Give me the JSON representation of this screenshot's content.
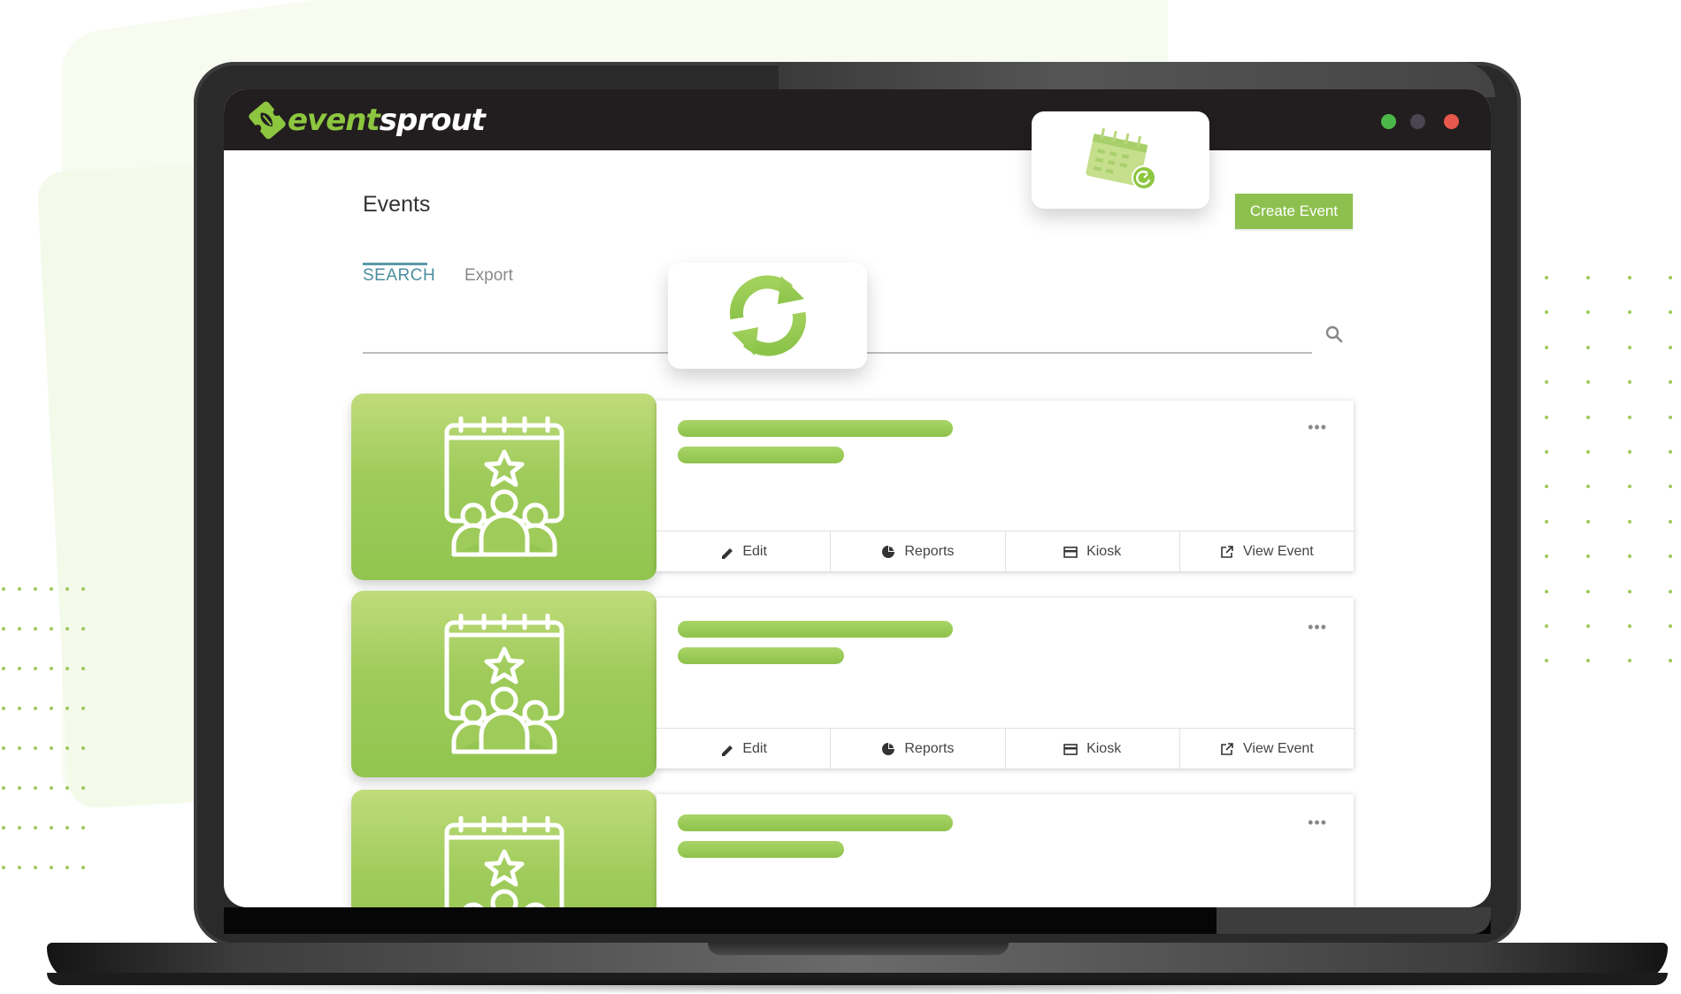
{
  "app": {
    "brand_part1": "event",
    "brand_part2": "sprout",
    "window_controls": [
      {
        "name": "maximize",
        "color": "#4cb84a"
      },
      {
        "name": "minimize",
        "color": "#4a4550"
      },
      {
        "name": "close",
        "color": "#e8574b"
      }
    ]
  },
  "colors": {
    "brand_green": "#8dc63f",
    "button_green": "#8dc04f",
    "tab_active": "#4a8fa0",
    "topbar": "#221e1f"
  },
  "page": {
    "title": "Events",
    "create_button": "Create Event",
    "tabs": [
      {
        "label": "SEARCH",
        "active": true
      },
      {
        "label": "Export",
        "active": false
      }
    ],
    "search": {
      "value": "",
      "placeholder": "",
      "icon": "search-icon"
    }
  },
  "popups": {
    "calendar_icon": "calendar-clock-icon",
    "refresh_icon": "refresh-icon"
  },
  "events": [
    {
      "icon": "event-calendar-people-icon",
      "more": "•••",
      "actions": [
        "Edit",
        "Reports",
        "Kiosk",
        "View Event"
      ]
    },
    {
      "icon": "event-calendar-people-icon",
      "more": "•••",
      "actions": [
        "Edit",
        "Reports",
        "Kiosk",
        "View Event"
      ]
    },
    {
      "icon": "event-calendar-people-icon",
      "more": "•••",
      "actions": []
    }
  ]
}
